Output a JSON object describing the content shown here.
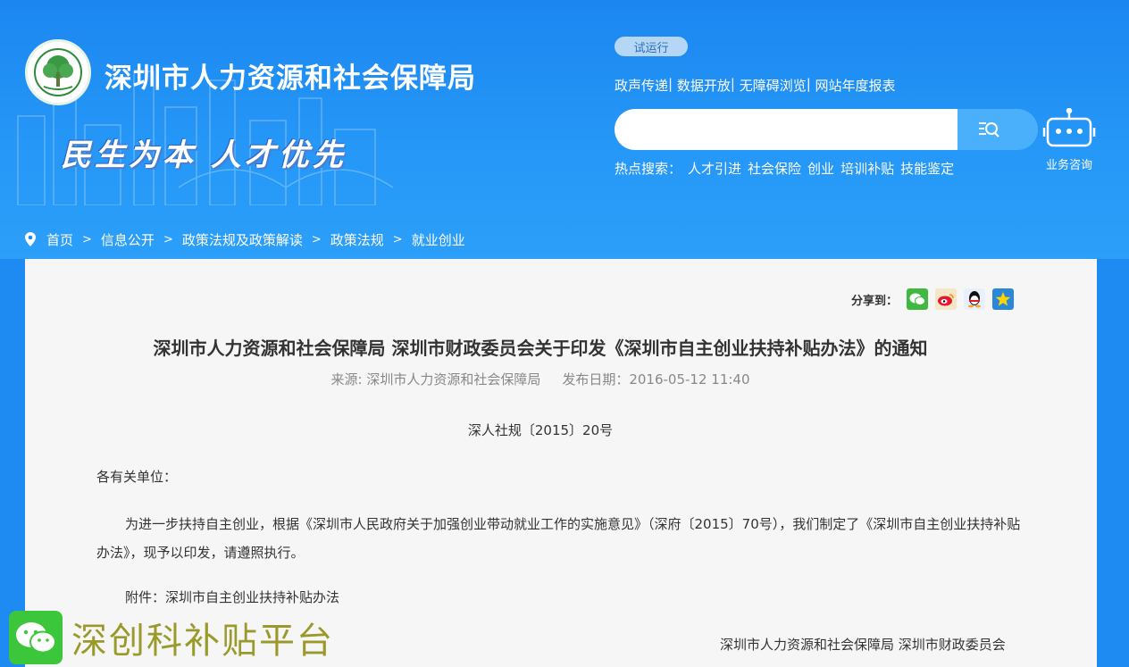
{
  "header": {
    "site_title": "深圳市人力资源和社会保障局",
    "slogan": "民生为本  人才优先",
    "trial_badge": "试运行",
    "top_links": [
      "政声传递",
      "数据开放",
      "无障碍浏览",
      "网站年度报表"
    ],
    "search": {
      "value": "",
      "placeholder": ""
    },
    "hot_search_label": "热点搜索：",
    "hot_search_terms": [
      "人才引进",
      "社会保险",
      "创业",
      "培训补贴",
      "技能鉴定"
    ],
    "robot_label": "业务咨询"
  },
  "breadcrumb": [
    "首页",
    "信息公开",
    "政策法规及政策解读",
    "政策法规",
    "就业创业"
  ],
  "article": {
    "share_label": "分享到：",
    "share_icons": [
      "wechat-icon",
      "weibo-icon",
      "qq-icon",
      "qzone-icon"
    ],
    "title": "深圳市人力资源和社会保障局 深圳市财政委员会关于印发《深圳市自主创业扶持补贴办法》的通知",
    "source": "来源: 深圳市人力资源和社会保障局",
    "publish_date": "发布日期：2016-05-12 11:40",
    "doc_number": "深人社规〔2015〕20号",
    "greeting": "各有关单位：",
    "paragraph": "为进一步扶持自主创业，根据《深圳市人民政府关于加强创业带动就业工作的实施意见》（深府〔2015〕70号），我们制定了《深圳市自主创业扶持补贴办法》，现予以印发，请遵照执行。",
    "attachment": "附件：深圳市自主创业扶持补贴办法",
    "signature": "深圳市人力资源和社会保障局 深圳市财政委员会"
  },
  "watermark": {
    "text": "深创科补贴平台"
  },
  "colors": {
    "banner": "#1e8bf2",
    "panel": "#f6f6f6",
    "search_button": "#4ab0fb",
    "watermark_text": "#9a9a2a"
  }
}
